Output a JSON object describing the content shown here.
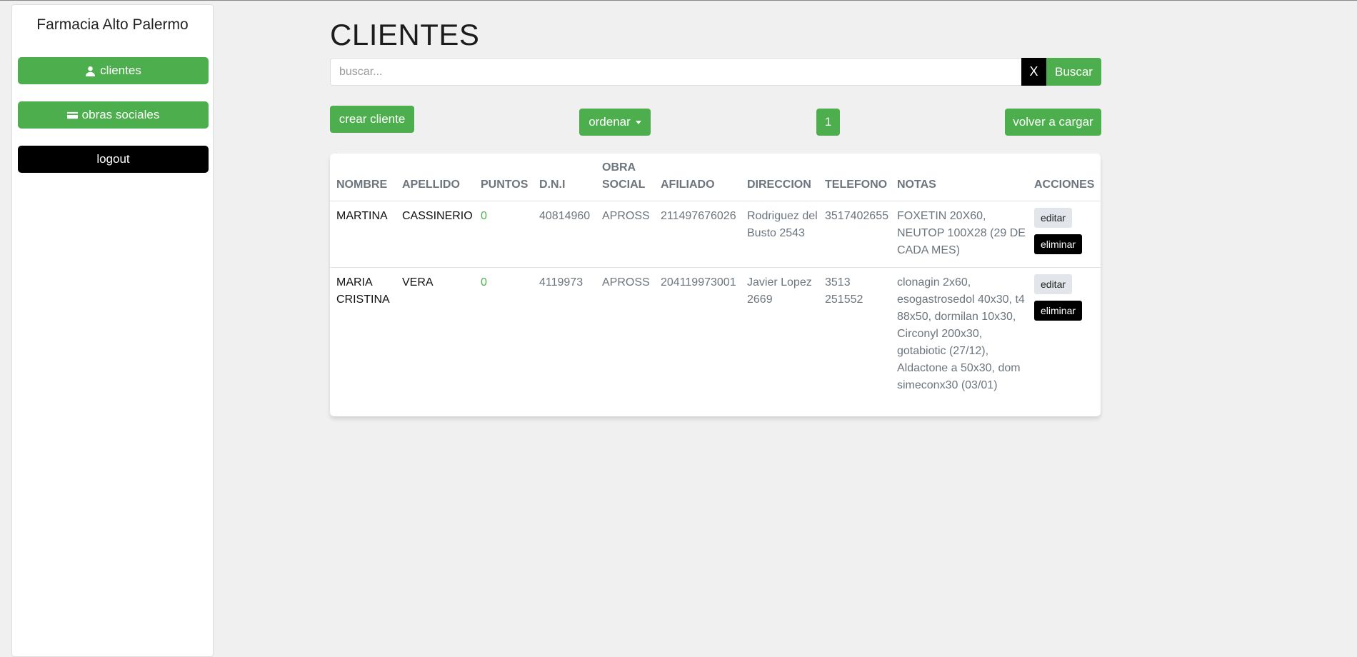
{
  "sidebar": {
    "brand": "Farmacia Alto Palermo",
    "items": [
      {
        "label": "clientes",
        "icon": "user-icon"
      },
      {
        "label": "obras sociales",
        "icon": "credit-card-icon"
      },
      {
        "label": "logout"
      }
    ]
  },
  "page": {
    "title": "CLIENTES"
  },
  "search": {
    "placeholder": "buscar...",
    "clear_label": "X",
    "button_label": "Buscar"
  },
  "toolbar": {
    "create_label": "crear cliente",
    "order_label": "ordenar",
    "page_number": "1",
    "reload_label": "volver a cargar"
  },
  "table": {
    "headers": [
      "NOMBRE",
      "APELLIDO",
      "PUNTOS",
      "D.N.I",
      "OBRA SOCIAL",
      "AFILIADO",
      "DIRECCION",
      "TELEFONO",
      "NOTAS",
      "ACCIONES"
    ],
    "rows": [
      {
        "nombre": "MARTINA",
        "apellido": "CASSINERIO",
        "puntos": "0",
        "dni": "40814960",
        "obra_social": "APROSS",
        "afiliado": "211497676026",
        "direccion": "Rodriguez del Busto 2543",
        "telefono": "3517402655",
        "notas": "FOXETIN 20X60, NEUTOP 100X28 (29 DE CADA MES)"
      },
      {
        "nombre": "MARIA CRISTINA",
        "apellido": "VERA",
        "puntos": "0",
        "dni": "4119973",
        "obra_social": "APROSS",
        "afiliado": "204119973001",
        "direccion": "Javier Lopez 2669",
        "telefono": "3513 251552",
        "notas": "clonagin 2x60, esogastrosedol 40x30, t4 88x50, dormilan 10x30, Circonyl 200x30, gotabiotic (27/12), Aldactone a 50x30, dom simeconx30 (03/01)"
      }
    ],
    "actions": {
      "edit_label": "editar",
      "delete_label": "eliminar"
    }
  },
  "colors": {
    "accent": "#4cae4c",
    "dark": "#000000",
    "background": "#f0f0f0"
  }
}
